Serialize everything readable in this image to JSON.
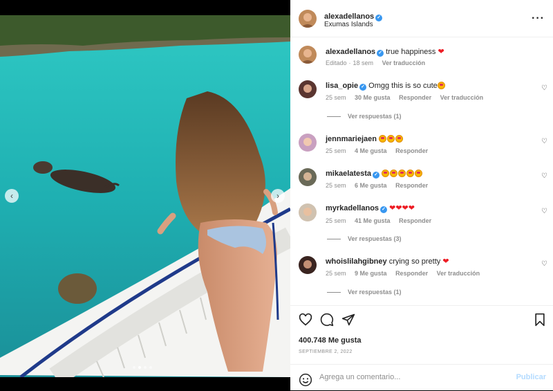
{
  "post": {
    "author": "alexadellanos",
    "location": "Exumas Islands",
    "caption_text": "true happiness",
    "caption_meta": {
      "edited": "Editado",
      "time": "18 sem",
      "translate": "Ver traducción"
    },
    "slides_total": 4,
    "slide_active": 2
  },
  "comments": [
    {
      "user": "lisa_opie",
      "verified": true,
      "text": "Omgg this is so cute",
      "time": "25 sem",
      "likes": "30 Me gusta",
      "reply": "Responder",
      "translate": "Ver traducción",
      "replies_label": "Ver respuestas (1)"
    },
    {
      "user": "jennmariejaen",
      "verified": false,
      "text": "",
      "time": "25 sem",
      "likes": "4 Me gusta",
      "reply": "Responder"
    },
    {
      "user": "mikaelatesta",
      "verified": true,
      "text": "",
      "time": "25 sem",
      "likes": "6 Me gusta",
      "reply": "Responder"
    },
    {
      "user": "myrkadellanos",
      "verified": true,
      "text": "",
      "time": "25 sem",
      "likes": "41 Me gusta",
      "reply": "Responder",
      "replies_label": "Ver respuestas (3)"
    },
    {
      "user": "whoislilahgibney",
      "verified": false,
      "text": "crying so pretty",
      "time": "25 sem",
      "likes": "9 Me gusta",
      "reply": "Responder",
      "translate": "Ver traducción",
      "replies_label": "Ver respuestas (1)"
    }
  ],
  "actions": {
    "likes_count": "400.748 Me gusta",
    "date": "SEPTIEMBRE 2, 2022",
    "comment_placeholder": "Agrega un comentario...",
    "publish_label": "Publicar"
  },
  "icons": {
    "like": "heart-outline-icon",
    "comment": "comment-bubble-icon",
    "share": "paper-plane-icon",
    "save": "bookmark-icon",
    "more": "more-dots-icon",
    "emoji": "smiley-icon"
  },
  "colors": {
    "verified": "#3897f0",
    "publish_disabled": "#b3dbff",
    "meta": "#8e8e8e",
    "heart_emoji": "#ed1c24"
  }
}
